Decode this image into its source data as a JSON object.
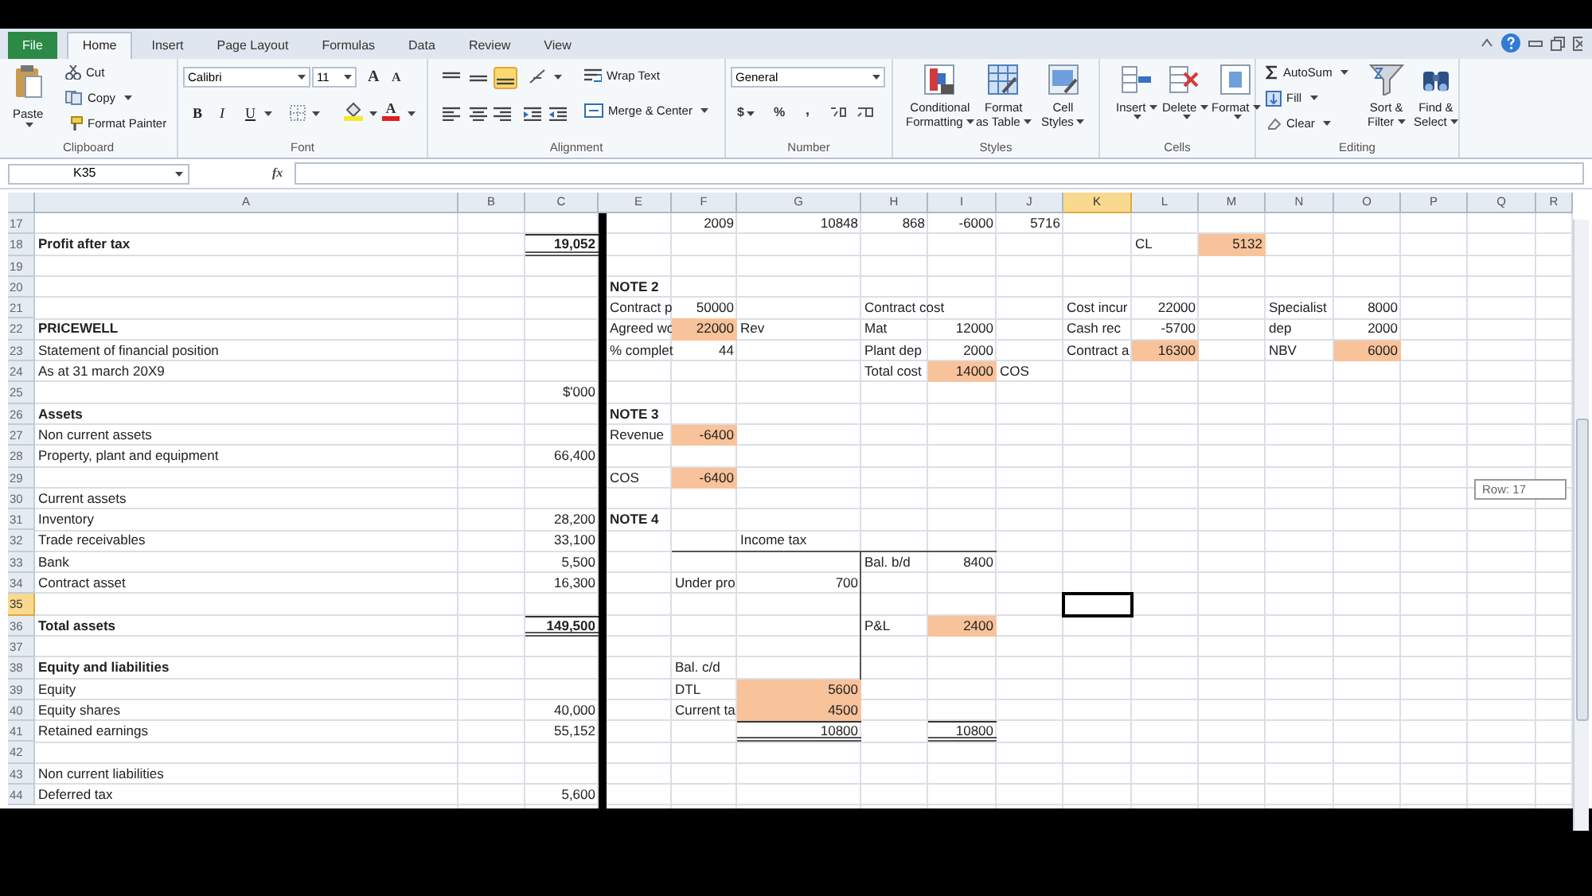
{
  "ribbon_tabs": [
    {
      "label": "File",
      "kind": "file",
      "selected": false
    },
    {
      "label": "Home",
      "kind": "tab",
      "selected": true
    },
    {
      "label": "Insert",
      "kind": "tab",
      "selected": false
    },
    {
      "label": "Page Layout",
      "kind": "tab",
      "selected": false
    },
    {
      "label": "Formulas",
      "kind": "tab",
      "selected": false
    },
    {
      "label": "Data",
      "kind": "tab",
      "selected": false
    },
    {
      "label": "Review",
      "kind": "tab",
      "selected": false
    },
    {
      "label": "View",
      "kind": "tab",
      "selected": false
    }
  ],
  "clipboard": {
    "paste": "Paste",
    "cut": "Cut",
    "copy": "Copy",
    "format_painter": "Format Painter",
    "group_label": "Clipboard"
  },
  "font": {
    "name": "Calibri",
    "size": "11",
    "grow": "A",
    "shrink": "A",
    "bold": "B",
    "italic": "I",
    "underline": "U",
    "font_color_button": "A",
    "group_label": "Font"
  },
  "alignment": {
    "bottom_align_on": true,
    "wrap_text": "Wrap Text",
    "merge_center": "Merge & Center",
    "group_label": "Alignment"
  },
  "number": {
    "format": "General",
    "currency": "$",
    "percent": "%",
    "comma": ",",
    "group_label": "Number"
  },
  "styles": {
    "buttons": [
      {
        "lines": [
          "Conditional",
          "Formatting"
        ]
      },
      {
        "lines": [
          "Format",
          "as Table"
        ]
      },
      {
        "lines": [
          "Cell",
          "Styles"
        ]
      }
    ],
    "group_label": "Styles"
  },
  "cells": {
    "buttons": [
      "Insert",
      "Delete",
      "Format"
    ],
    "group_label": "Cells"
  },
  "editing": {
    "autosum": "AutoSum",
    "fill": "Fill",
    "clear": "Clear",
    "sort": [
      "Sort &",
      "Filter"
    ],
    "find": [
      "Find &",
      "Select"
    ],
    "group_label": "Editing"
  },
  "formula_bar": {
    "name_box": "K35",
    "fx": "fx"
  },
  "sheet": {
    "columns": [
      {
        "label": "A",
        "selected": false
      },
      {
        "label": "B",
        "selected": false
      },
      {
        "label": "C",
        "selected": false
      },
      {
        "label": "E",
        "selected": false
      },
      {
        "label": "F",
        "selected": false
      },
      {
        "label": "G",
        "selected": false
      },
      {
        "label": "H",
        "selected": false
      },
      {
        "label": "I",
        "selected": false
      },
      {
        "label": "J",
        "selected": false
      },
      {
        "label": "K",
        "selected": true
      },
      {
        "label": "L",
        "selected": false
      },
      {
        "label": "M",
        "selected": false
      },
      {
        "label": "N",
        "selected": false
      },
      {
        "label": "O",
        "selected": false
      },
      {
        "label": "P",
        "selected": false
      },
      {
        "label": "Q",
        "selected": false
      },
      {
        "label": "R",
        "selected": false
      }
    ],
    "rows": [
      {
        "number": "17",
        "selected": false,
        "cells": [
          "",
          "",
          "",
          "",
          {
            "text": "2009",
            "kind": "number"
          },
          {
            "text": "10848",
            "kind": "number"
          },
          {
            "text": "868",
            "kind": "number"
          },
          {
            "text": "-6000",
            "kind": "number"
          },
          {
            "text": "5716",
            "kind": "number"
          }
        ]
      },
      {
        "number": "18",
        "selected": false,
        "cells": [
          {
            "text": "Profit after tax",
            "kind": "heading"
          },
          "",
          {
            "text": "19,052",
            "kind": "total"
          },
          "",
          "",
          "",
          "",
          "",
          "",
          "",
          {
            "text": "CL",
            "kind": "label"
          },
          {
            "text": "5132",
            "kind": "highlight"
          }
        ]
      },
      {
        "number": "19",
        "selected": false
      },
      {
        "number": "20",
        "selected": false,
        "cells": [
          "",
          "",
          "",
          {
            "text": "NOTE 2",
            "kind": "heading"
          }
        ]
      },
      {
        "number": "21",
        "selected": false,
        "cells": [
          "",
          "",
          "",
          {
            "text": "Contract p",
            "kind": "label"
          },
          {
            "text": "50000",
            "kind": "number"
          },
          "",
          {
            "text": "Contract cost",
            "kind": "label"
          },
          "",
          "",
          {
            "text": "Cost incur",
            "kind": "label"
          },
          {
            "text": "22000",
            "kind": "number"
          },
          "",
          {
            "text": "Specialist",
            "kind": "label"
          },
          {
            "text": "8000",
            "kind": "number"
          }
        ]
      },
      {
        "number": "22",
        "selected": false,
        "cells": [
          {
            "text": "PRICEWELL",
            "kind": "heading"
          },
          "",
          "",
          {
            "text": "Agreed wo",
            "kind": "label"
          },
          {
            "text": "22000",
            "kind": "highlight"
          },
          {
            "text": "Rev",
            "kind": "label"
          },
          {
            "text": "Mat",
            "kind": "label"
          },
          {
            "text": "12000",
            "kind": "number"
          },
          "",
          {
            "text": "Cash rec",
            "kind": "label"
          },
          {
            "text": "-5700",
            "kind": "number"
          },
          "",
          {
            "text": "dep",
            "kind": "label"
          },
          {
            "text": "2000",
            "kind": "number"
          }
        ]
      },
      {
        "number": "23",
        "selected": false,
        "cells": [
          {
            "text": "Statement of financial position",
            "kind": "label"
          },
          "",
          "",
          {
            "text": "% complet",
            "kind": "label"
          },
          {
            "text": "44",
            "kind": "number"
          },
          "",
          {
            "text": "Plant dep",
            "kind": "label"
          },
          {
            "text": "2000",
            "kind": "number"
          },
          "",
          {
            "text": "Contract a",
            "kind": "label"
          },
          {
            "text": "16300",
            "kind": "highlight"
          },
          "",
          {
            "text": "NBV",
            "kind": "label"
          },
          {
            "text": "6000",
            "kind": "highlight"
          }
        ]
      },
      {
        "number": "24",
        "selected": false,
        "cells": [
          {
            "text": "As at 31 march 20X9",
            "kind": "label"
          },
          "",
          "",
          "",
          "",
          "",
          {
            "text": "Total cost",
            "kind": "label"
          },
          {
            "text": "14000",
            "kind": "highlight"
          },
          {
            "text": "COS",
            "kind": "label"
          }
        ]
      },
      {
        "number": "25",
        "selected": false,
        "cells": [
          "",
          "",
          {
            "text": "$'000",
            "kind": "number"
          }
        ]
      },
      {
        "number": "26",
        "selected": false,
        "cells": [
          {
            "text": "Assets",
            "kind": "heading"
          },
          "",
          "",
          {
            "text": "NOTE 3",
            "kind": "heading"
          }
        ]
      },
      {
        "number": "27",
        "selected": false,
        "cells": [
          {
            "text": "Non current assets",
            "kind": "label"
          },
          "",
          "",
          {
            "text": "Revenue",
            "kind": "label"
          },
          {
            "text": "-6400",
            "kind": "highlight"
          }
        ]
      },
      {
        "number": "28",
        "selected": false,
        "cells": [
          {
            "text": "Property, plant and equipment",
            "kind": "label"
          },
          "",
          {
            "text": "66,400",
            "kind": "number"
          }
        ]
      },
      {
        "number": "29",
        "selected": false,
        "cells": [
          "",
          "",
          "",
          {
            "text": "COS",
            "kind": "label"
          },
          {
            "text": "-6400",
            "kind": "highlight"
          }
        ]
      },
      {
        "number": "30",
        "selected": false,
        "cells": [
          {
            "text": "Current assets",
            "kind": "label"
          }
        ]
      },
      {
        "number": "31",
        "selected": false,
        "cells": [
          {
            "text": "Inventory",
            "kind": "label"
          },
          "",
          {
            "text": "28,200",
            "kind": "number"
          },
          {
            "text": "NOTE 4",
            "kind": "heading"
          }
        ]
      },
      {
        "number": "32",
        "selected": false,
        "cells": [
          {
            "text": "Trade receivables",
            "kind": "label"
          },
          "",
          {
            "text": "33,100",
            "kind": "number"
          },
          "",
          "",
          {
            "text": "Income tax",
            "kind": "label"
          }
        ]
      },
      {
        "number": "33",
        "selected": false,
        "cells": [
          {
            "text": "Bank",
            "kind": "label"
          },
          "",
          {
            "text": "5,500",
            "kind": "number"
          },
          "",
          "",
          "",
          {
            "text": "Bal. b/d",
            "kind": "label"
          },
          {
            "text": "8400",
            "kind": "number"
          }
        ]
      },
      {
        "number": "34",
        "selected": false,
        "cells": [
          {
            "text": "Contract asset",
            "kind": "label"
          },
          "",
          {
            "text": "16,300",
            "kind": "number"
          },
          "",
          {
            "text": "Under pro",
            "kind": "label"
          },
          {
            "text": "700",
            "kind": "number"
          }
        ]
      },
      {
        "number": "35",
        "selected": true
      },
      {
        "number": "36",
        "selected": false,
        "cells": [
          {
            "text": "Total assets",
            "kind": "heading"
          },
          "",
          {
            "text": "149,500",
            "kind": "total"
          },
          "",
          "",
          "",
          {
            "text": "P&L",
            "kind": "label"
          },
          {
            "text": "2400",
            "kind": "highlight"
          }
        ]
      },
      {
        "number": "37",
        "selected": false
      },
      {
        "number": "38",
        "selected": false,
        "cells": [
          {
            "text": "Equity and liabilities",
            "kind": "heading"
          },
          "",
          "",
          "",
          {
            "text": "Bal. c/d",
            "kind": "label"
          }
        ]
      },
      {
        "number": "39",
        "selected": false,
        "cells": [
          {
            "text": "Equity",
            "kind": "label"
          },
          "",
          "",
          "",
          {
            "text": "DTL",
            "kind": "label"
          },
          {
            "text": "5600",
            "kind": "highlight"
          }
        ]
      },
      {
        "number": "40",
        "selected": false,
        "cells": [
          {
            "text": "Equity shares",
            "kind": "label"
          },
          "",
          {
            "text": "40,000",
            "kind": "number"
          },
          "",
          {
            "text": "Current ta",
            "kind": "label"
          },
          {
            "text": "4500",
            "kind": "highlight"
          }
        ]
      },
      {
        "number": "41",
        "selected": false,
        "cells": [
          {
            "text": "Retained earnings",
            "kind": "label"
          },
          "",
          {
            "text": "55,152",
            "kind": "number"
          },
          "",
          "",
          {
            "text": "10800",
            "kind": "sum"
          },
          "",
          {
            "text": "10800",
            "kind": "sum"
          }
        ]
      },
      {
        "number": "42",
        "selected": false
      },
      {
        "number": "43",
        "selected": false,
        "cells": [
          {
            "text": "Non current liabilities",
            "kind": "label"
          }
        ]
      },
      {
        "number": "44",
        "selected": false,
        "cells": [
          {
            "text": "Deferred tax",
            "kind": "label"
          },
          "",
          {
            "text": "5,600",
            "kind": "number"
          }
        ]
      }
    ]
  },
  "tooltip": "Row: 17"
}
